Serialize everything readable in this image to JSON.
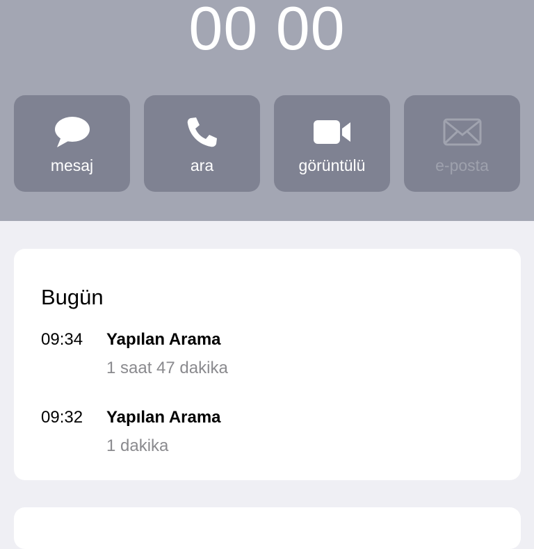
{
  "contact": {
    "name": "00 00"
  },
  "actions": [
    {
      "label": "mesaj",
      "icon": "message-bubble-icon",
      "enabled": true
    },
    {
      "label": "ara",
      "icon": "phone-icon",
      "enabled": true
    },
    {
      "label": "görüntülü",
      "icon": "video-camera-icon",
      "enabled": true
    },
    {
      "label": "e-posta",
      "icon": "envelope-icon",
      "enabled": false
    }
  ],
  "history": {
    "day": "Bugün",
    "calls": [
      {
        "time": "09:34",
        "type": "Yapılan Arama",
        "duration": "1 saat 47 dakika"
      },
      {
        "time": "09:32",
        "type": "Yapılan Arama",
        "duration": "1 dakika"
      }
    ]
  },
  "colors": {
    "header_bg": "#a3a6b3",
    "action_bg": "#7f8292",
    "page_bg": "#efeff4",
    "secondary_text": "#8a8a8e"
  }
}
